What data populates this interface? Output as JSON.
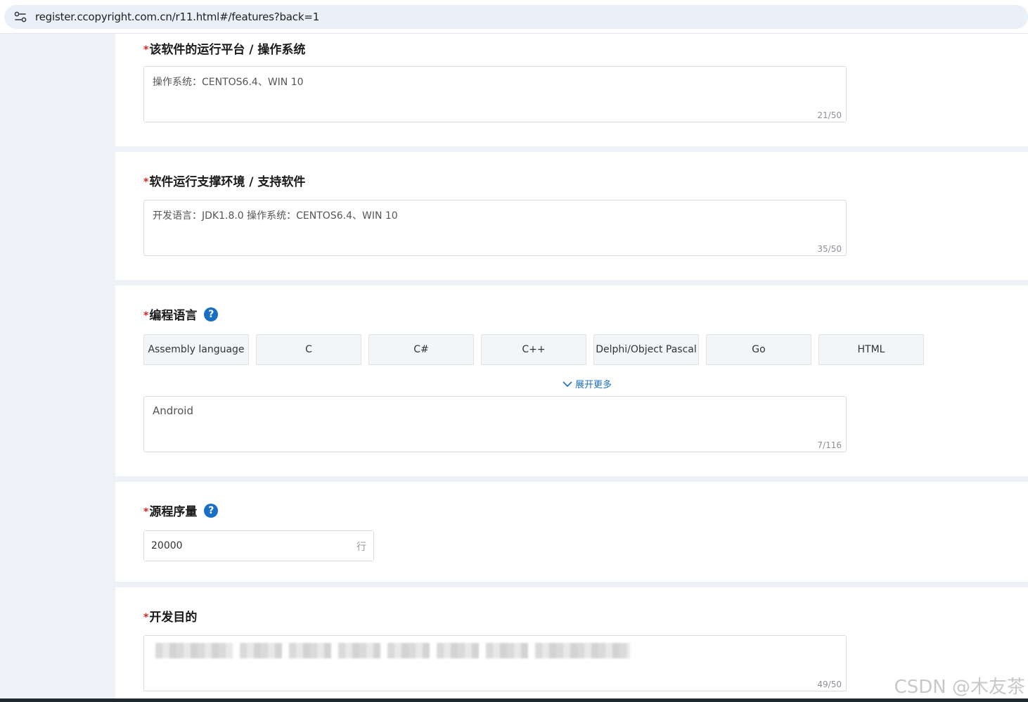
{
  "browser": {
    "url": "register.ccopyright.com.cn/r11.html#/features?back=1",
    "icon": "site-settings-icon"
  },
  "sections": {
    "platform": {
      "required_mark": "*",
      "label": "该软件的运行平台 / 操作系统",
      "value": "操作系统：CENTOS6.4、WIN 10",
      "counter": "21/50"
    },
    "environment": {
      "required_mark": "*",
      "label": "软件运行支撑环境 / 支持软件",
      "value": "开发语言：JDK1.8.0 操作系统：CENTOS6.4、WIN 10",
      "counter": "35/50"
    },
    "language": {
      "required_mark": "*",
      "label": "编程语言",
      "help": "?",
      "options": [
        "Assembly language",
        "C",
        "C#",
        "C++",
        "Delphi/Object Pascal",
        "Go",
        "HTML"
      ],
      "expand_label": "展开更多",
      "value": "Android",
      "counter": "7/116"
    },
    "source_lines": {
      "required_mark": "*",
      "label": "源程序量",
      "help": "?",
      "value": "20000",
      "unit": "行"
    },
    "purpose": {
      "required_mark": "*",
      "label": "开发目的",
      "counter": "49/50"
    }
  },
  "watermark": "CSDN @木友茶",
  "colors": {
    "accent": "#1a6fc4",
    "required": "#e02020",
    "page_bg": "#eef2f6"
  }
}
